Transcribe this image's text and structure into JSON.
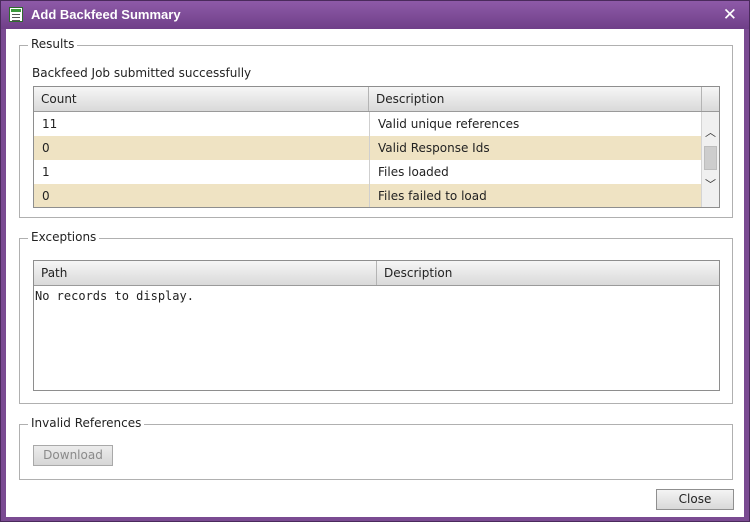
{
  "window": {
    "title": "Add Backfeed Summary",
    "close_glyph": "✕"
  },
  "results": {
    "legend": "Results",
    "status": "Backfeed Job submitted successfully",
    "columns": [
      "Count",
      "Description"
    ],
    "rows": [
      {
        "count": "11",
        "description": "Valid unique references"
      },
      {
        "count": "0",
        "description": "Valid Response Ids"
      },
      {
        "count": "1",
        "description": "Files loaded"
      },
      {
        "count": "0",
        "description": "Files failed to load"
      }
    ],
    "scroll_up_glyph": "︿",
    "scroll_down_glyph": "﹀"
  },
  "exceptions": {
    "legend": "Exceptions",
    "columns": [
      "Path",
      "Description"
    ],
    "empty_text": "No records to display."
  },
  "invalid_references": {
    "legend": "Invalid References",
    "download_label": "Download"
  },
  "footer": {
    "close_label": "Close"
  },
  "colors": {
    "titlebar": "#7b4a94",
    "row_alt": "#efe3c3"
  }
}
